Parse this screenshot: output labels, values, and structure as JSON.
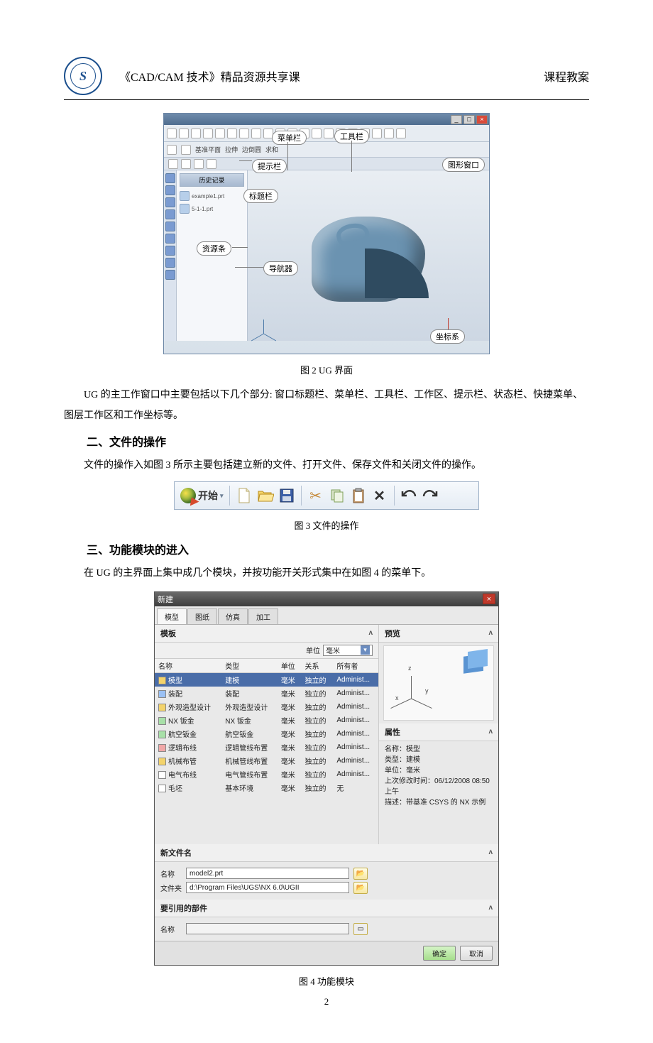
{
  "header": {
    "title": "《CAD/CAM 技术》精品资源共享课",
    "right": "课程教案"
  },
  "fig2": {
    "caption": "图 2   UG 界面",
    "labels": {
      "menubar": "菜单栏",
      "toolbar": "工具栏",
      "promptbar": "提示栏",
      "titlebar": "标题栏",
      "graphwin": "图形窗口",
      "resource": "资源条",
      "navigator": "导航器",
      "csys": "坐标系"
    },
    "panel": {
      "title": "历史记录",
      "items": [
        "example1.prt",
        "5-1-1.prt"
      ]
    }
  },
  "p1": "UG 的主工作窗口中主要包括以下几个部分: 窗口标题栏、菜单栏、工具栏、工作区、提示栏、状态栏、快捷菜单、图层工作区和工作坐标等。",
  "h2": "二、文件的操作",
  "p2": "文件的操作入如图 3 所示主要包括建立新的文件、打开文件、保存文件和关闭文件的操作。",
  "fig3": {
    "start": "开始",
    "caption": "图 3   文件的操作",
    "icons": {
      "new": "new-file-icon",
      "open": "open-folder-icon",
      "save": "save-disk-icon",
      "cut": "scissors-icon",
      "copy": "copy-icon",
      "paste": "clipboard-icon",
      "delete": "delete-x-icon",
      "undo": "undo-icon",
      "redo": "redo-icon"
    }
  },
  "h3": "三、功能模块的进入",
  "p3": "在 UG 的主界面上集中成几个模块，并按功能开关形式集中在如图 4 的菜单下。",
  "fig4": {
    "caption": "图 4  功能模块",
    "dlg_title": "新建",
    "tabs": [
      "模型",
      "图纸",
      "仿真",
      "加工"
    ],
    "section_templates": "模板",
    "section_preview": "预览",
    "unit_label": "单位",
    "unit_value": "毫米",
    "cols": [
      "名称",
      "类型",
      "单位",
      "关系",
      "所有者"
    ],
    "rows": [
      {
        "name": "模型",
        "type": "建模",
        "unit": "毫米",
        "rel": "独立的",
        "own": "Administ...",
        "sel": true,
        "ico": "i-yel"
      },
      {
        "name": "装配",
        "type": "装配",
        "unit": "毫米",
        "rel": "独立的",
        "own": "Administ...",
        "ico": "i-blu"
      },
      {
        "name": "外观造型设计",
        "type": "外观造型设计",
        "unit": "毫米",
        "rel": "独立的",
        "own": "Administ...",
        "ico": "i-yel"
      },
      {
        "name": "NX 钣金",
        "type": "NX 钣金",
        "unit": "毫米",
        "rel": "独立的",
        "own": "Administ...",
        "ico": "i-grn"
      },
      {
        "name": "航空钣金",
        "type": "航空钣金",
        "unit": "毫米",
        "rel": "独立的",
        "own": "Administ...",
        "ico": "i-grn"
      },
      {
        "name": "逻辑布线",
        "type": "逻辑管线布置",
        "unit": "毫米",
        "rel": "独立的",
        "own": "Administ...",
        "ico": "i-red"
      },
      {
        "name": "机械布管",
        "type": "机械管线布置",
        "unit": "毫米",
        "rel": "独立的",
        "own": "Administ...",
        "ico": "i-yel"
      },
      {
        "name": "电气布线",
        "type": "电气管线布置",
        "unit": "毫米",
        "rel": "独立的",
        "own": "Administ...",
        "ico": "i-wht"
      },
      {
        "name": "毛坯",
        "type": "基本环境",
        "unit": "毫米",
        "rel": "独立的",
        "own": "无",
        "ico": "i-wht"
      }
    ],
    "props_title": "属性",
    "props": {
      "name": "名称：模型",
      "type": "类型：建模",
      "unit": "单位：毫米",
      "time": "上次修改时间：06/12/2008 08:50 上午",
      "desc": "描述：带基准 CSYS 的 NX 示例"
    },
    "newfile_title": "新文件名",
    "name_label": "名称",
    "name_value": "model2.prt",
    "folder_label": "文件夹",
    "folder_value": "d:\\Program Files\\UGS\\NX 6.0\\UGII",
    "ref_title": "要引用的部件",
    "ref_name_label": "名称",
    "ok": "确定",
    "cancel": "取消"
  },
  "page": "2"
}
